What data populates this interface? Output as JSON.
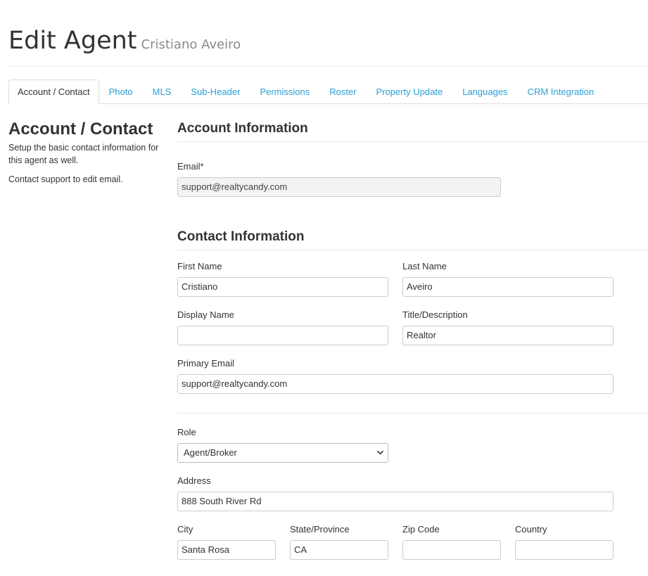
{
  "header": {
    "title": "Edit Agent",
    "subtitle": "Cristiano Aveiro"
  },
  "tabs": [
    {
      "label": "Account / Contact",
      "active": true
    },
    {
      "label": "Photo"
    },
    {
      "label": "MLS"
    },
    {
      "label": "Sub-Header"
    },
    {
      "label": "Permissions"
    },
    {
      "label": "Roster"
    },
    {
      "label": "Property Update"
    },
    {
      "label": "Languages"
    },
    {
      "label": "CRM Integration"
    }
  ],
  "sidebar": {
    "title": "Account / Contact",
    "description": "Setup the basic contact information for this agent as well.",
    "note": "Contact support to edit email."
  },
  "account": {
    "section_title": "Account Information",
    "email_label": "Email*",
    "email_value": "support@realtycandy.com"
  },
  "contact": {
    "section_title": "Contact Information",
    "first_name_label": "First Name",
    "first_name_value": "Cristiano",
    "last_name_label": "Last Name",
    "last_name_value": "Aveiro",
    "display_name_label": "Display Name",
    "display_name_value": "",
    "title_label": "Title/Description",
    "title_value": "Realtor",
    "primary_email_label": "Primary Email",
    "primary_email_value": "support@realtycandy.com",
    "role_label": "Role",
    "role_value": "Agent/Broker",
    "address_label": "Address",
    "address_value": "888 South River Rd",
    "city_label": "City",
    "city_value": "Santa Rosa",
    "state_label": "State/Province",
    "state_value": "CA",
    "zip_label": "Zip Code",
    "zip_value": "",
    "country_label": "Country",
    "country_value": ""
  },
  "colors": {
    "link": "#2a9fd6",
    "text": "#333333",
    "muted": "#8a8a8a",
    "disabled_bg": "#f3f3f3"
  }
}
